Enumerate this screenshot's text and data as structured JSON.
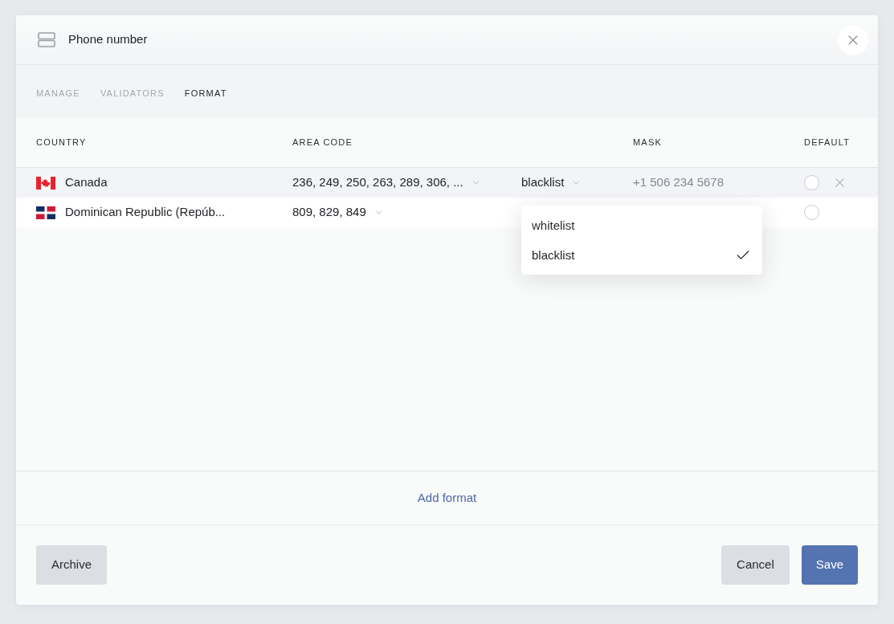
{
  "dialog": {
    "title": "Phone number"
  },
  "tabs": [
    {
      "label": "MANAGE",
      "selected": false
    },
    {
      "label": "VALIDATORS",
      "selected": false
    },
    {
      "label": "FORMAT",
      "selected": true
    }
  ],
  "table": {
    "columns": [
      "COUNTRY",
      "AREA CODE",
      "MASK",
      "DEFAULT"
    ],
    "rows": [
      {
        "flag": {
          "kind": "canada"
        },
        "country": "Canada",
        "area_codes": "236, 249, 250, 263, 289, 306, ...",
        "list_type": "blacklist",
        "list_type_options": [
          {
            "label": "whitelist",
            "selected": false
          },
          {
            "label": "blacklist",
            "selected": true
          }
        ],
        "mask": "+1 506 234 5678",
        "default": false,
        "highlighted": true
      },
      {
        "flag": {
          "kind": "dominican"
        },
        "country": "Dominican Republic (Repúb...",
        "area_codes": "809, 829, 849",
        "default": false,
        "highlighted": false
      }
    ]
  },
  "add_format": "Add format",
  "footer": {
    "left_buttons": [
      {
        "label": "Archive",
        "kind": "secondary"
      }
    ],
    "right_buttons": [
      {
        "label": "Cancel",
        "kind": "secondary"
      },
      {
        "label": "Save",
        "kind": "primary"
      }
    ]
  }
}
